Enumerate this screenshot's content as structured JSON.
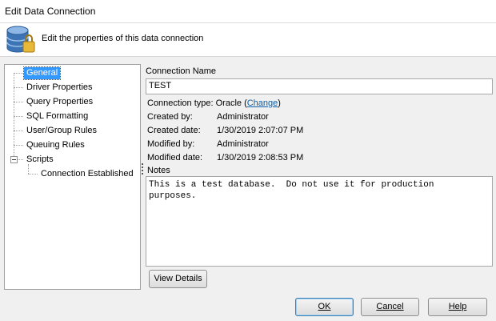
{
  "window": {
    "title": "Edit Data Connection"
  },
  "header": {
    "description": "Edit the properties of this data connection",
    "icon": "database-lock-icon"
  },
  "tree": {
    "items": [
      {
        "label": "General",
        "selected": true
      },
      {
        "label": "Driver Properties"
      },
      {
        "label": "Query Properties"
      },
      {
        "label": "SQL Formatting"
      },
      {
        "label": "User/Group Rules"
      },
      {
        "label": "Queuing Rules"
      },
      {
        "label": "Scripts",
        "expanded": true
      },
      {
        "label": "Connection Established"
      }
    ]
  },
  "general": {
    "connection_name_label": "Connection Name",
    "connection_name_value": "TEST",
    "connection_type_label": "Connection type: Oracle (",
    "connection_type_link": "Change",
    "connection_type_close": ")",
    "created_by_label": "Created by:",
    "created_by_value": "Administrator",
    "created_date_label": "Created date:",
    "created_date_value": "1/30/2019 2:07:07 PM",
    "modified_by_label": "Modified by:",
    "modified_by_value": "Administrator",
    "modified_date_label": "Modified date:",
    "modified_date_value": "1/30/2019 2:08:53 PM",
    "notes_label": "Notes",
    "notes_value": "This is a test database.  Do not use it for production\npurposes.",
    "view_details_label": "View Details"
  },
  "buttons": {
    "ok": "OK",
    "cancel": "Cancel",
    "help": "Help"
  },
  "colors": {
    "selection": "#3399ff",
    "link": "#0a5ea8",
    "dialog_bg": "#f0f0f0"
  }
}
